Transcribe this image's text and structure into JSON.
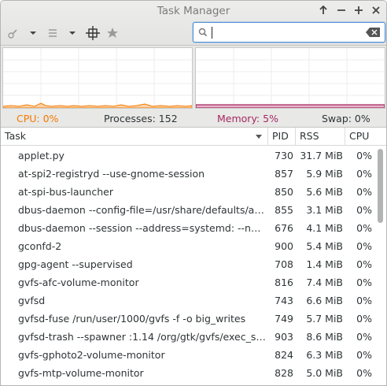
{
  "window": {
    "title": "Task Manager"
  },
  "search": {
    "value": "",
    "placeholder": ""
  },
  "stats": {
    "cpu": "CPU: 0%",
    "processes": "Processes: 152",
    "memory": "Memory: 5%",
    "swap": "Swap: 0%"
  },
  "colors": {
    "cpu": "#f57900",
    "memory": "#a5285f"
  },
  "columns": {
    "task": "Task",
    "pid": "PID",
    "rss": "RSS",
    "cpu": "CPU"
  },
  "rows": [
    {
      "task": "applet.py",
      "pid": "730",
      "rss": "31.7 MiB",
      "cpu": "0%"
    },
    {
      "task": "at-spi2-registryd --use-gnome-session",
      "pid": "857",
      "rss": "5.9 MiB",
      "cpu": "0%"
    },
    {
      "task": "at-spi-bus-launcher",
      "pid": "850",
      "rss": "5.6 MiB",
      "cpu": "0%"
    },
    {
      "task": "dbus-daemon --config-file=/usr/share/defaults/at…",
      "pid": "855",
      "rss": "3.1 MiB",
      "cpu": "0%"
    },
    {
      "task": "dbus-daemon --session --address=systemd: --no…",
      "pid": "676",
      "rss": "4.1 MiB",
      "cpu": "0%"
    },
    {
      "task": "gconfd-2",
      "pid": "900",
      "rss": "5.4 MiB",
      "cpu": "0%"
    },
    {
      "task": "gpg-agent --supervised",
      "pid": "708",
      "rss": "1.4 MiB",
      "cpu": "0%"
    },
    {
      "task": "gvfs-afc-volume-monitor",
      "pid": "816",
      "rss": "7.4 MiB",
      "cpu": "0%"
    },
    {
      "task": "gvfsd",
      "pid": "743",
      "rss": "6.6 MiB",
      "cpu": "0%"
    },
    {
      "task": "gvfsd-fuse /run/user/1000/gvfs -f -o big_writes",
      "pid": "749",
      "rss": "5.7 MiB",
      "cpu": "0%"
    },
    {
      "task": "gvfsd-trash --spawner :1.14 /org/gtk/gvfs/exec_s…",
      "pid": "903",
      "rss": "8.6 MiB",
      "cpu": "0%"
    },
    {
      "task": "gvfs-gphoto2-volume-monitor",
      "pid": "824",
      "rss": "6.3 MiB",
      "cpu": "0%"
    },
    {
      "task": "gvfs-mtp-volume-monitor",
      "pid": "828",
      "rss": "5.0 MiB",
      "cpu": "0%"
    }
  ]
}
